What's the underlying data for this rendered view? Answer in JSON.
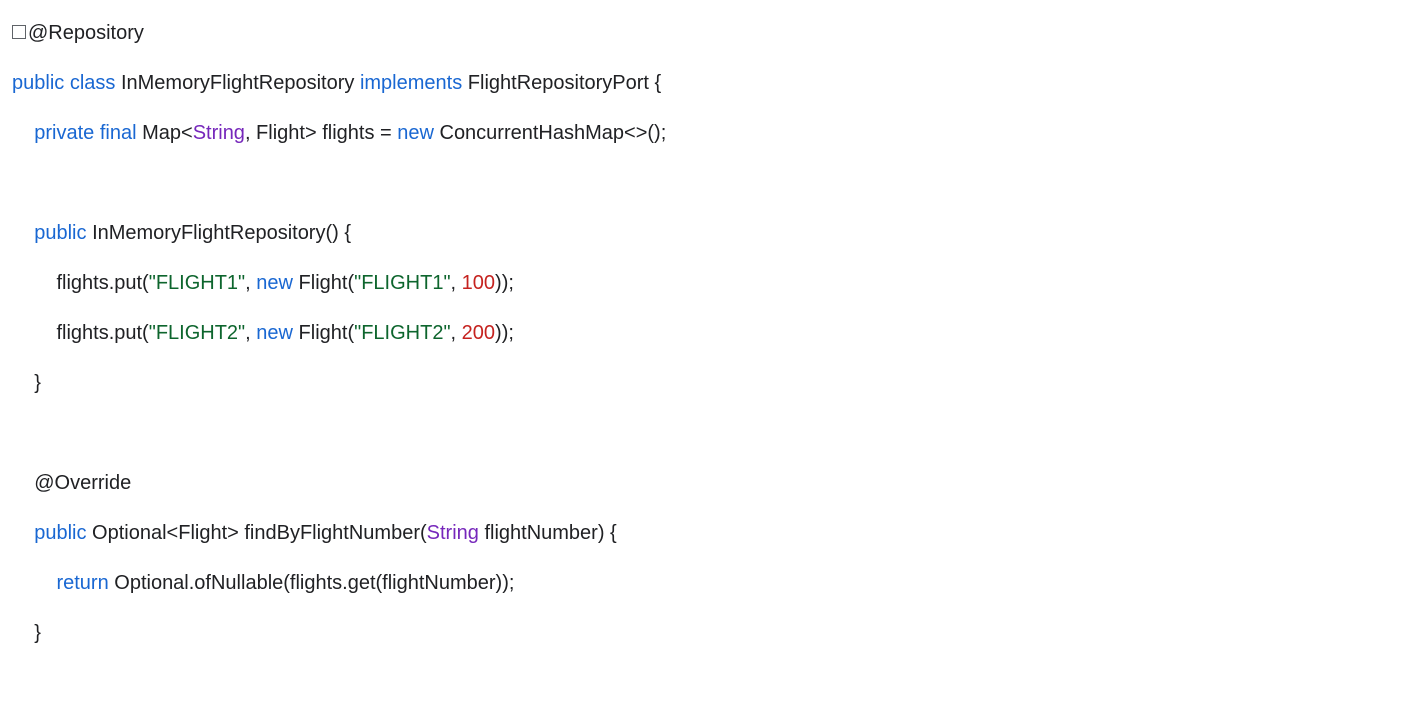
{
  "code": {
    "annotation_repository": "@Repository",
    "kw_public": "public",
    "kw_class": "class",
    "class_name": "InMemoryFlightRepository",
    "kw_implements": "implements",
    "interface_name": "FlightRepositoryPort",
    "kw_private": "private",
    "kw_final": "final",
    "map_decl_prefix": "Map<",
    "type_string": "String",
    "map_decl_mid": ", Flight> flights = ",
    "kw_new": "new",
    "map_decl_suffix": " ConcurrentHashMap<>();",
    "ctor_name": "InMemoryFlightRepository()",
    "put1_prefix": "flights.put(",
    "str_flight1": "\"FLIGHT1\"",
    "put1_mid": ", ",
    "put1_flight_ctor": " Flight(",
    "num_100": "100",
    "put1_suffix": "));",
    "put2_prefix": "flights.put(",
    "str_flight2": "\"FLIGHT2\"",
    "put2_mid": ", ",
    "put2_flight_ctor": " Flight(",
    "num_200": "200",
    "put2_suffix": "));",
    "annotation_override": "@Override",
    "method_return_prefix": " Optional<Flight> findByFlightNumber(",
    "method_param_name": " flightNumber) {",
    "kw_return": "return",
    "return_body": " Optional.ofNullable(flights.get(flightNumber));",
    "brace_open": " {",
    "brace_close": "}",
    "indent1": "    ",
    "indent2": "        "
  }
}
